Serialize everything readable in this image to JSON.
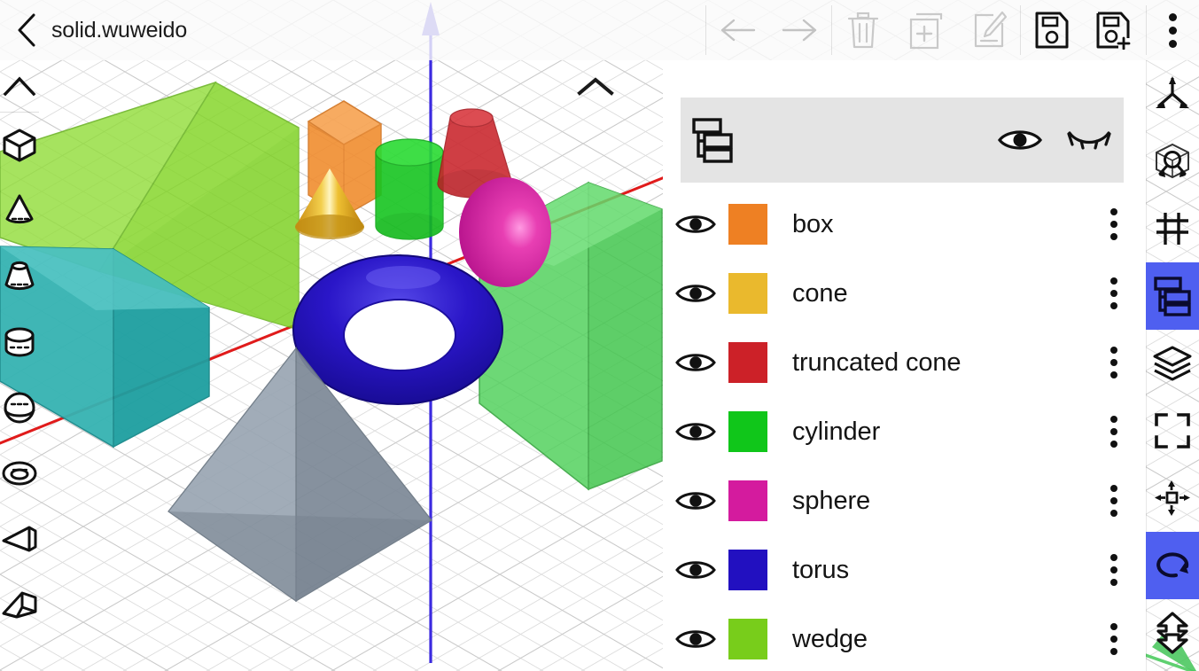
{
  "header": {
    "back_icon": "chevron-left-icon",
    "title": "solid.wuweido",
    "tools": [
      {
        "name": "undo-button",
        "icon": "arrow-left-icon",
        "enabled": false
      },
      {
        "name": "redo-button",
        "icon": "arrow-right-icon",
        "enabled": false
      },
      {
        "name": "delete-button",
        "icon": "trash-icon",
        "enabled": false
      },
      {
        "name": "duplicate-button",
        "icon": "copy-plus-icon",
        "enabled": false
      },
      {
        "name": "edit-button",
        "icon": "pencil-edit-icon",
        "enabled": false
      },
      {
        "name": "save-button",
        "icon": "floppy-disk-icon",
        "enabled": true
      },
      {
        "name": "save-as-button",
        "icon": "floppy-disk-plus-icon",
        "enabled": true
      },
      {
        "name": "overflow-menu-button",
        "icon": "three-dots-vertical-icon",
        "enabled": true
      }
    ]
  },
  "left_toolbar": {
    "collapse_icon": "chevron-up-icon",
    "items": [
      {
        "name": "primitive-box",
        "icon": "box-icon"
      },
      {
        "name": "primitive-cone",
        "icon": "cone-icon"
      },
      {
        "name": "primitive-truncated-cone",
        "icon": "truncated-cone-icon"
      },
      {
        "name": "primitive-cylinder",
        "icon": "cylinder-icon"
      },
      {
        "name": "primitive-sphere",
        "icon": "sphere-icon"
      },
      {
        "name": "primitive-torus",
        "icon": "torus-icon"
      },
      {
        "name": "primitive-wedge",
        "icon": "wedge-icon"
      },
      {
        "name": "primitive-wedge-prism",
        "icon": "wedge-prism-icon"
      }
    ]
  },
  "right_toolbar": {
    "active_color": "#4f5ff0",
    "items": [
      {
        "name": "axes-toggle-button",
        "icon": "axes-icon",
        "active": false
      },
      {
        "name": "view-cube-button",
        "icon": "view-cube-icon",
        "active": false
      },
      {
        "name": "grid-toggle-button",
        "icon": "grid-icon",
        "active": false
      },
      {
        "name": "object-tree-button",
        "icon": "tree-list-icon",
        "active": true
      },
      {
        "name": "layers-button",
        "icon": "layers-icon",
        "active": false
      },
      {
        "name": "fit-to-screen-button",
        "icon": "fit-screen-icon",
        "active": false
      },
      {
        "name": "move-tool-button",
        "icon": "move-arrows-icon",
        "active": false
      },
      {
        "name": "rotate-tool-button",
        "icon": "rotate-icon",
        "active": true
      },
      {
        "name": "mirror-tool-button",
        "icon": "flip-mirror-icon",
        "active": false
      }
    ]
  },
  "object_panel": {
    "header": {
      "tree_icon": "tree-list-icon",
      "show_all_icon": "eye-open-icon",
      "hide_all_icon": "eye-closed-icon",
      "background": "#e4e4e4"
    },
    "items": [
      {
        "label": "box",
        "color": "#ee8023",
        "visible": true
      },
      {
        "label": "cone",
        "color": "#eab92d",
        "visible": true
      },
      {
        "label": "truncated cone",
        "color": "#cc2128",
        "visible": true
      },
      {
        "label": "cylinder",
        "color": "#10c61a",
        "visible": true
      },
      {
        "label": "sphere",
        "color": "#d41b9e",
        "visible": true
      },
      {
        "label": "torus",
        "color": "#2210c0",
        "visible": true
      },
      {
        "label": "wedge",
        "color": "#78cd1b",
        "visible": true
      }
    ]
  },
  "viewport": {
    "name": "3d-viewport",
    "background": "#ffffff",
    "grid_color": "#cfcfcf",
    "axes": {
      "x_color": "#e01b1b",
      "y_color": "#5fd070",
      "z_color": "#3b2ae0"
    },
    "objects": [
      {
        "name": "wedge-green",
        "color": "#78cd1b"
      },
      {
        "name": "wedge-teal",
        "color": "#1a9a9c"
      },
      {
        "name": "box-orange",
        "color": "#ee8023"
      },
      {
        "name": "cone-gold",
        "color": "#e8b227"
      },
      {
        "name": "cylinder-green",
        "color": "#10c61a"
      },
      {
        "name": "truncated-cone-red",
        "color": "#c42027"
      },
      {
        "name": "sphere-magenta",
        "color": "#d41b9e"
      },
      {
        "name": "torus-blue",
        "color": "#2210c0"
      },
      {
        "name": "prism-green",
        "color": "#3fc24a"
      },
      {
        "name": "pyramid-gray",
        "color": "#8b97a3"
      }
    ]
  }
}
